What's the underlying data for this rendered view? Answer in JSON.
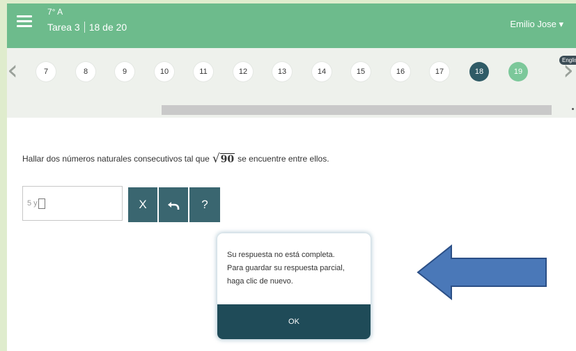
{
  "header": {
    "course": "7° A",
    "task": "Tarea 3",
    "progress": "18 de 20",
    "user": "Emilio Jose ▾"
  },
  "nav": {
    "prev_icon": "chevron-left-icon",
    "next_icon": "chevron-right-icon",
    "language_badge": "English",
    "questions": [
      {
        "label": "7",
        "state": "default"
      },
      {
        "label": "8",
        "state": "default"
      },
      {
        "label": "9",
        "state": "default"
      },
      {
        "label": "10",
        "state": "default"
      },
      {
        "label": "11",
        "state": "default"
      },
      {
        "label": "12",
        "state": "default"
      },
      {
        "label": "13",
        "state": "default"
      },
      {
        "label": "14",
        "state": "default"
      },
      {
        "label": "15",
        "state": "default"
      },
      {
        "label": "16",
        "state": "default"
      },
      {
        "label": "17",
        "state": "default"
      },
      {
        "label": "18",
        "state": "active"
      },
      {
        "label": "19",
        "state": "next"
      }
    ]
  },
  "question": {
    "before": "Hallar dos números naturales consecutivos tal que",
    "radicand": "90",
    "after": "se encuentre entre ellos."
  },
  "answer": {
    "value": "5 y"
  },
  "tools": {
    "clear_label": "X",
    "undo_icon": "undo-icon",
    "help_label": "?"
  },
  "tooltip": {
    "line1": "Su respuesta no está completa.",
    "line2": "Para guardar su respuesta parcial,",
    "line3": "haga clic de nuevo.",
    "ok_label": "OK"
  },
  "colors": {
    "header": "#6dbb8c",
    "active_question": "#2f5b66",
    "next_question": "#7cc89a",
    "tool_button": "#3a6670",
    "ok_button": "#1f4b58",
    "arrow_fill": "#4a78b8",
    "page_border": "#dfeccd"
  }
}
